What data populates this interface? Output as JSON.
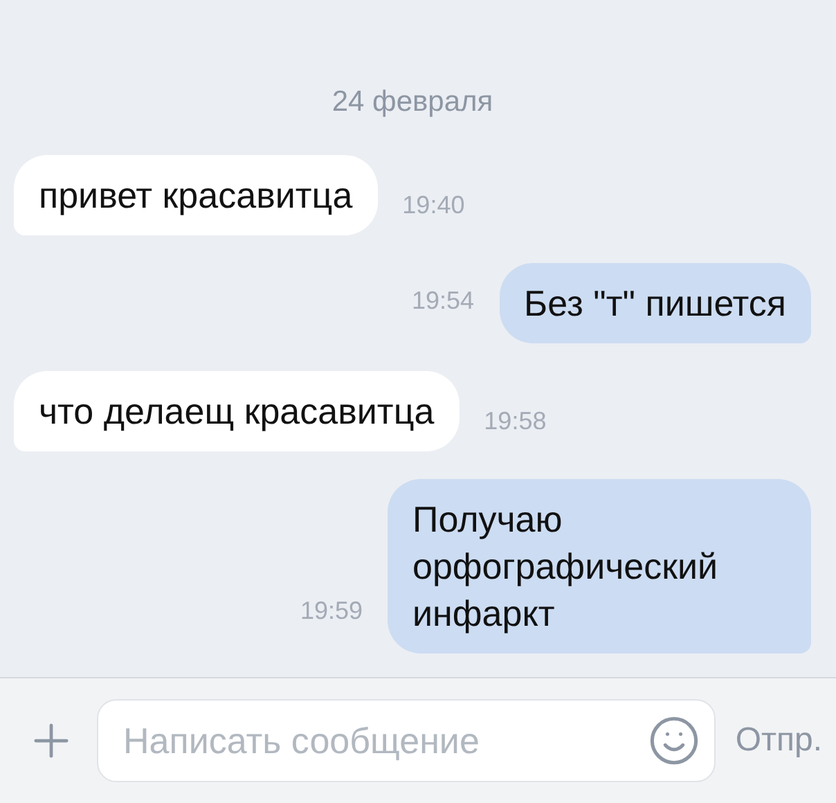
{
  "date": "24 февраля",
  "messages": [
    {
      "kind": "incoming",
      "text": "привет красавитца",
      "time": "19:40"
    },
    {
      "kind": "outgoing",
      "text": "Без \"т\" пишется",
      "time": "19:54"
    },
    {
      "kind": "incoming",
      "text": "что делаещ красавитца",
      "time": "19:58"
    },
    {
      "kind": "outgoing",
      "text": "Получаю орфографический инфаркт",
      "time": "19:59"
    }
  ],
  "composer": {
    "placeholder": "Написать сообщение",
    "send": "Отпр."
  }
}
